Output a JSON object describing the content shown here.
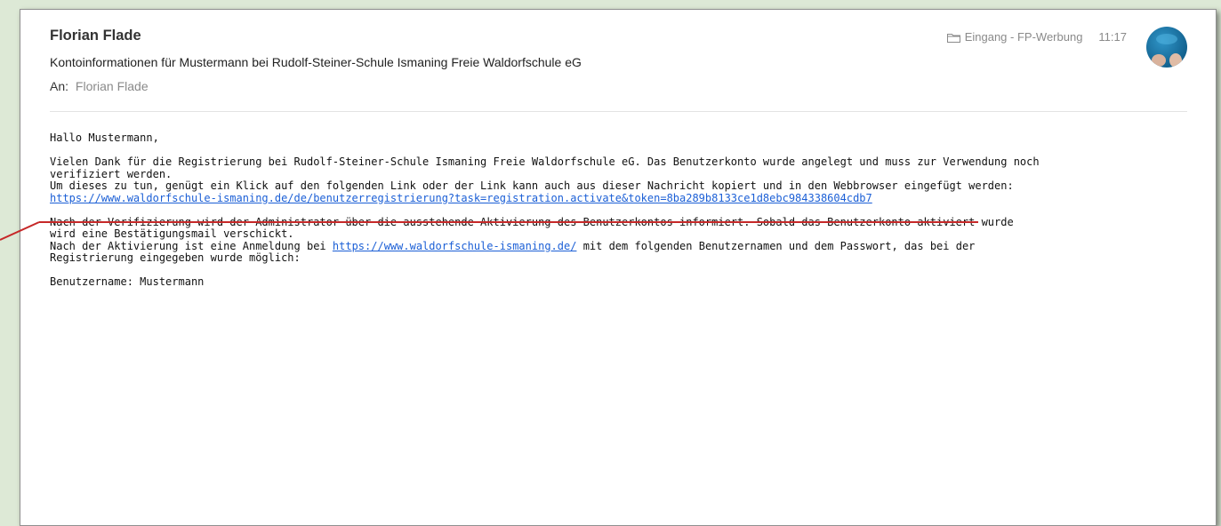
{
  "email": {
    "sender": "Florian Flade",
    "subject": "Kontoinformationen für Mustermann bei Rudolf-Steiner-Schule Ismaning Freie Waldorfschule eG",
    "to_label": "An:",
    "to_name": "Florian Flade",
    "folder": "Eingang - FP-Werbung",
    "time": "11:17",
    "body": {
      "greeting": "Hallo Mustermann,",
      "para1_line1": "Vielen Dank für die Registrierung bei Rudolf-Steiner-Schule Ismaning Freie Waldorfschule eG. Das Benutzerkonto wurde angelegt und muss zur Verwendung noch",
      "para1_line2": "verifiziert werden.",
      "para1_line3": "Um dieses zu tun, genügt ein Klick auf den folgenden Link oder der Link kann auch aus dieser Nachricht kopiert und in den Webbrowser eingefügt werden:",
      "activation_link": "https://www.waldorfschule-ismaning.de/de/benutzerregistrierung?task=registration.activate&token=8ba289b8133ce1d8ebc984338604cdb7",
      "para2_line1": "Nach der Verifizierung wird der Administrator über die ausstehende Aktivierung des Benutzerkontos informiert. Sobald das Benutzerkonto aktiviert wurde",
      "para2_line2": "wird eine Bestätigungsmail verschickt.",
      "para2_line3_prefix": "Nach der Aktivierung ist eine Anmeldung bei",
      "site_link": "https://www.waldorfschule-ismaning.de/",
      "para2_line3_suffix": "mit dem folgenden Benutzernamen und dem Passwort, das bei der",
      "para2_line4": "Registrierung eingegeben wurde möglich:",
      "username_line": "Benutzername: Mustermann"
    }
  },
  "colors": {
    "background": "#dde9d6",
    "link": "#1b5fd6",
    "annotation": "#c62828",
    "avatar": "#1f7fb3"
  },
  "icons": {
    "folder": "folder-icon",
    "avatar": "avatar"
  }
}
